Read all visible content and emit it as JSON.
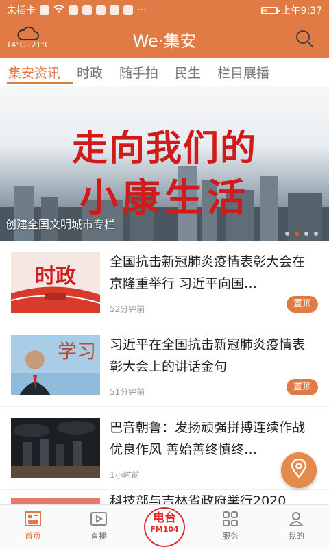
{
  "status_bar": {
    "carrier": "未插卡",
    "time": "上午9:37"
  },
  "header": {
    "temperature": "14°C~21°C",
    "app_title": "We·集安",
    "weather_icon": "cloud-icon",
    "search_icon": "search-icon"
  },
  "tabs": [
    {
      "label": "集安资讯"
    },
    {
      "label": "时政"
    },
    {
      "label": "随手拍"
    },
    {
      "label": "民生"
    },
    {
      "label": "栏目展播"
    }
  ],
  "banner": {
    "headline_line1": "走向我们的",
    "headline_line2": "小康生活",
    "caption": "创建全国文明城市专栏",
    "slide_count": 4,
    "active_slide": 1
  },
  "news": [
    {
      "thumb_text": "时政",
      "title": "全国抗击新冠肺炎疫情表彰大会在京隆重举行 习近平向国…",
      "time": "52分钟前",
      "pinned": "置顶"
    },
    {
      "thumb_text": "学习",
      "title": "习近平在全国抗击新冠肺炎疫情表彰大会上的讲话金句",
      "time": "51分钟前",
      "pinned": "置顶"
    },
    {
      "title": "巴音朝鲁：发扬顽强拼搏连续作战优良作风 善始善终慎终…",
      "time": "1小时前"
    }
  ],
  "last_item_partial": "科技部与吉林省政府举行2020",
  "bottom_nav": [
    {
      "label": "首页",
      "icon": "home-icon"
    },
    {
      "label": "直播",
      "icon": "live-icon"
    },
    {
      "label": "",
      "icon": "radio-icon"
    },
    {
      "label": "服务",
      "icon": "grid-icon"
    },
    {
      "label": "我的",
      "icon": "user-icon"
    }
  ],
  "radio": {
    "line1": "电台",
    "line2": "FM104"
  },
  "colors": {
    "brand": "#e07b45",
    "radio_red": "#e02b2b"
  }
}
